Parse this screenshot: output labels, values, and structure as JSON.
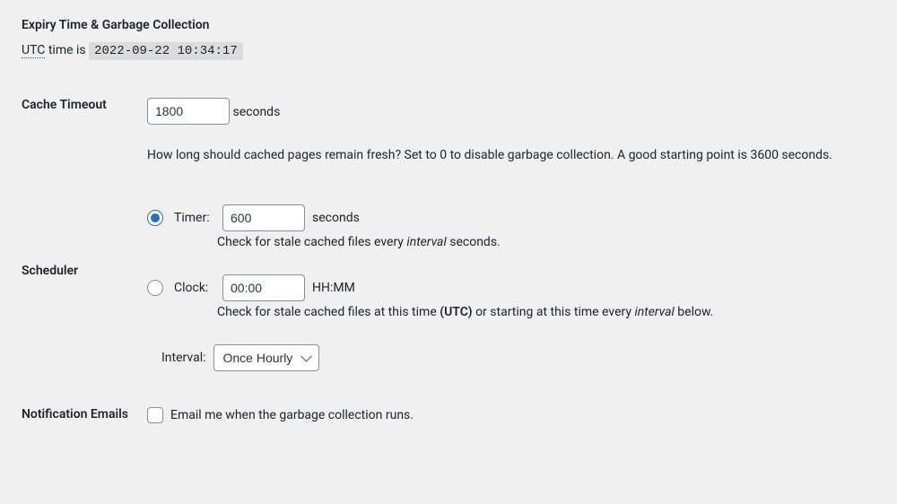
{
  "section": {
    "title": "Expiry Time & Garbage Collection"
  },
  "utc": {
    "abbr": "UTC",
    "label_suffix": " time is ",
    "timestamp": "2022-09-22 10:34:17"
  },
  "cache_timeout": {
    "label": "Cache Timeout",
    "value": "1800",
    "unit": "seconds",
    "description": "How long should cached pages remain fresh? Set to 0 to disable garbage collection. A good starting point is 3600 seconds."
  },
  "scheduler": {
    "label": "Scheduler",
    "timer": {
      "radio_label": "Timer:",
      "value": "600",
      "unit": "seconds",
      "help_pre": "Check for stale cached files every ",
      "help_em": "interval",
      "help_post": " seconds."
    },
    "clock": {
      "radio_label": "Clock:",
      "value": "00:00",
      "unit": "HH:MM",
      "help_pre": "Check for stale cached files at this time ",
      "help_strong": "(UTC)",
      "help_mid": " or starting at this time every ",
      "help_em": "interval",
      "help_post": " below."
    },
    "interval": {
      "label": "Interval:",
      "selected": "Once Hourly"
    }
  },
  "notification": {
    "label": "Notification Emails",
    "checkbox_label": "Email me when the garbage collection runs."
  }
}
